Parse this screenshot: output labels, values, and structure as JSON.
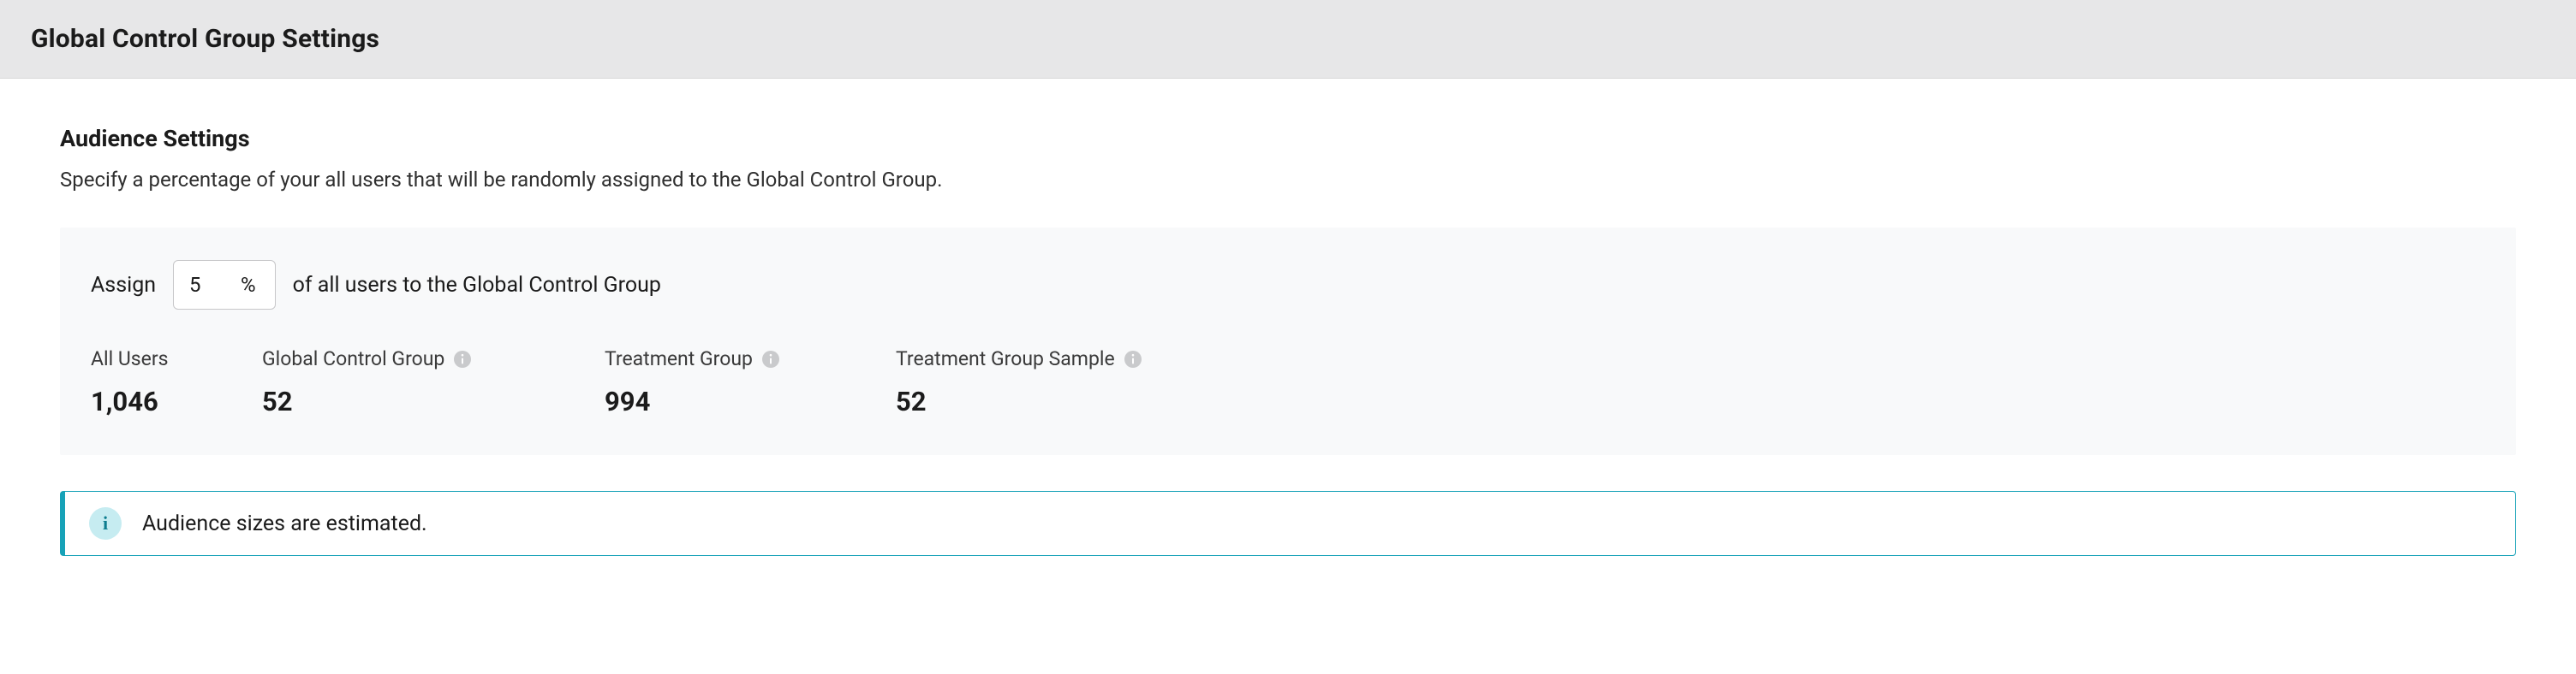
{
  "header": {
    "title": "Global Control Group Settings"
  },
  "section": {
    "title": "Audience Settings",
    "description": "Specify a percentage of your all users that will be randomly assigned to the Global Control Group."
  },
  "assign": {
    "prefix": "Assign",
    "value": "5",
    "percent_sign": "%",
    "suffix": "of all users to the Global Control Group"
  },
  "stats": [
    {
      "label": "All Users",
      "value": "1,046",
      "has_info": false
    },
    {
      "label": "Global Control Group",
      "value": "52",
      "has_info": true
    },
    {
      "label": "Treatment Group",
      "value": "994",
      "has_info": true
    },
    {
      "label": "Treatment Group Sample",
      "value": "52",
      "has_info": true
    }
  ],
  "alert": {
    "badge_letter": "i",
    "text": "Audience sizes are estimated."
  }
}
